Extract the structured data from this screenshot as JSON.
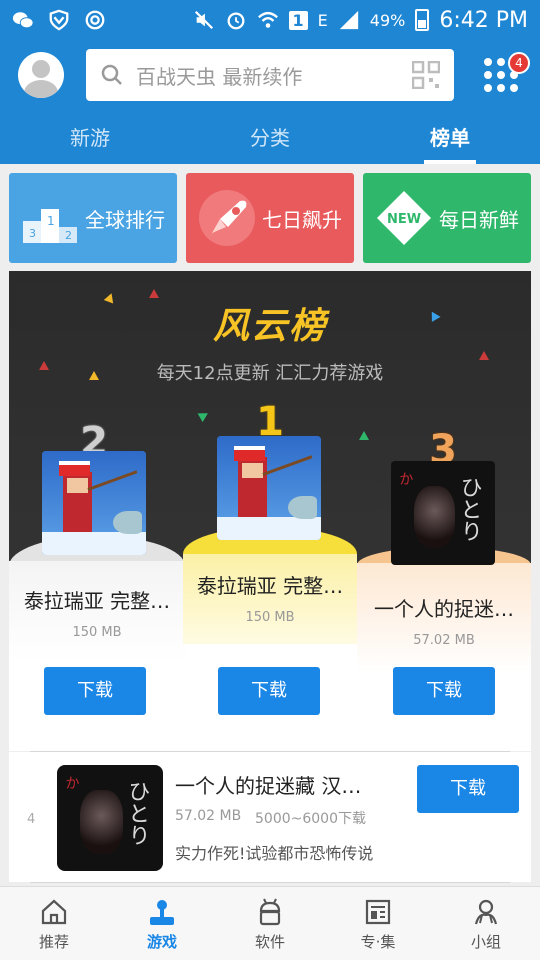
{
  "status_bar": {
    "battery_pct": "49%",
    "time": "6:42 PM",
    "sim_indicator": "1",
    "network": "E"
  },
  "header": {
    "search_placeholder": "百战天虫 最新续作",
    "notification_count": "4"
  },
  "tabs": [
    {
      "label": "新游",
      "active": false
    },
    {
      "label": "分类",
      "active": false
    },
    {
      "label": "榜单",
      "active": true
    }
  ],
  "categories": [
    {
      "label": "全球排行",
      "icon": "podium-icon",
      "color": "#4aa3e2"
    },
    {
      "label": "七日飙升",
      "icon": "rocket-icon",
      "color": "#e95a5d"
    },
    {
      "label": "每日新鲜",
      "icon": "new-badge-icon",
      "color": "#2fb86b",
      "badge": "NEW"
    }
  ],
  "leaderboard": {
    "title": "风云榜",
    "subtitle": "每天12点更新 汇汇力荐游戏",
    "top3": [
      {
        "rank": "2",
        "name": "泰拉瑞亚 完整…",
        "size": "150 MB",
        "button": "下载",
        "icon": "terraria-game-icon"
      },
      {
        "rank": "1",
        "name": "泰拉瑞亚 完整…",
        "size": "150 MB",
        "button": "下载",
        "icon": "terraria-game-icon"
      },
      {
        "rank": "3",
        "name": "一个人的捉迷…",
        "size": "57.02 MB",
        "button": "下载",
        "icon": "horror-game-icon"
      }
    ]
  },
  "list": [
    {
      "rank": "4",
      "name": "一个人的捉迷藏 汉…",
      "size": "57.02 MB",
      "downloads": "5000~6000下载",
      "desc": "实力作死!试验都市恐怖传说",
      "button": "下载",
      "icon": "horror-game-icon"
    }
  ],
  "bottom_nav": [
    {
      "label": "推荐",
      "icon": "home-icon",
      "active": false
    },
    {
      "label": "游戏",
      "icon": "joystick-icon",
      "active": true
    },
    {
      "label": "软件",
      "icon": "android-icon",
      "active": false
    },
    {
      "label": "专·集",
      "icon": "collection-icon",
      "active": false
    },
    {
      "label": "小组",
      "icon": "group-icon",
      "active": false
    }
  ],
  "colors": {
    "brand_blue": "#1f86d3",
    "button_blue": "#1a86e6",
    "gold": "#f7c325"
  }
}
